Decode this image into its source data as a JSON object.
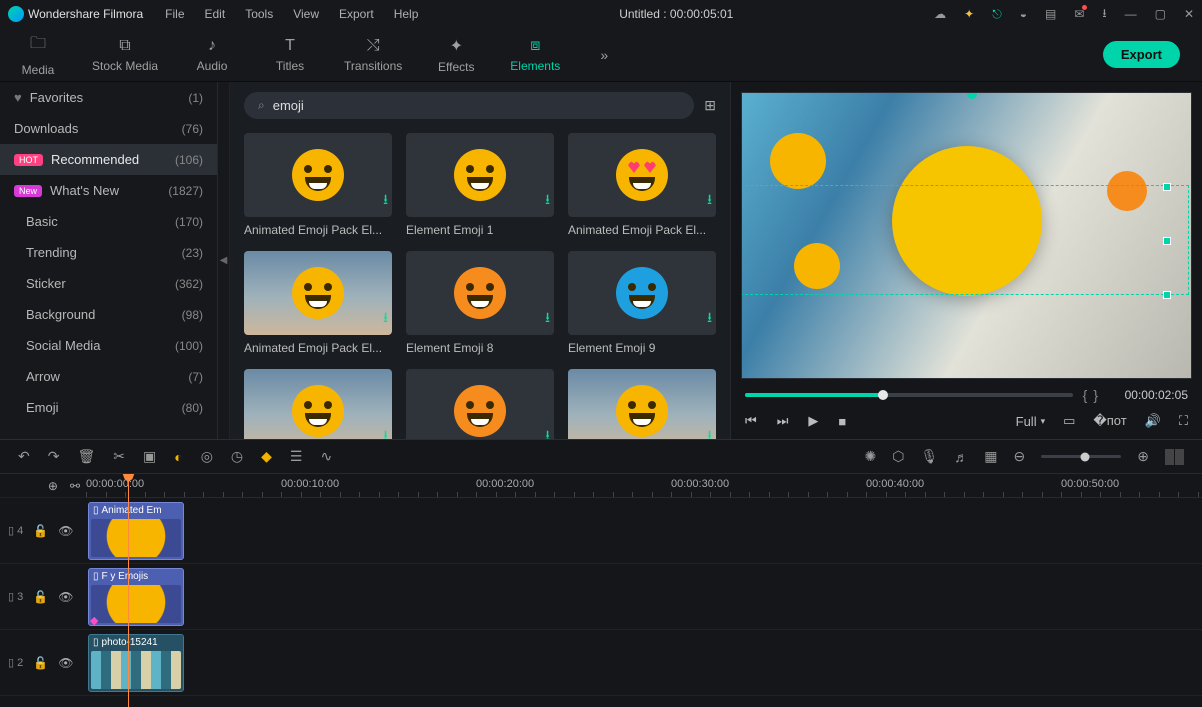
{
  "brand": "Wondershare Filmora",
  "menu": [
    "File",
    "Edit",
    "Tools",
    "View",
    "Export",
    "Help"
  ],
  "title_center": "Untitled : 00:00:05:01",
  "tabs": [
    {
      "label": "Media",
      "icon": "folder"
    },
    {
      "label": "Stock Media",
      "icon": "camera"
    },
    {
      "label": "Audio",
      "icon": "music"
    },
    {
      "label": "Titles",
      "icon": "text"
    },
    {
      "label": "Transitions",
      "icon": "swap"
    },
    {
      "label": "Effects",
      "icon": "sparkle"
    },
    {
      "label": "Elements",
      "icon": "elements",
      "active": true
    }
  ],
  "export_label": "Export",
  "sidebar": {
    "items": [
      {
        "label": "Favorites",
        "count": "(1)",
        "icon": "heart"
      },
      {
        "label": "Downloads",
        "count": "(76)"
      },
      {
        "label": "Recommended",
        "count": "(106)",
        "badge": "HOT",
        "active": true
      },
      {
        "label": "What's New",
        "count": "(1827)",
        "badge": "New"
      },
      {
        "label": "Basic",
        "count": "(170)"
      },
      {
        "label": "Trending",
        "count": "(23)"
      },
      {
        "label": "Sticker",
        "count": "(362)"
      },
      {
        "label": "Background",
        "count": "(98)"
      },
      {
        "label": "Social Media",
        "count": "(100)"
      },
      {
        "label": "Arrow",
        "count": "(7)"
      },
      {
        "label": "Emoji",
        "count": "(80)"
      }
    ]
  },
  "search_value": "emoji",
  "cards": [
    {
      "label": "Animated Emoji Pack El...",
      "variant": "sweat"
    },
    {
      "label": "Element Emoji 1",
      "variant": "smile"
    },
    {
      "label": "Animated Emoji Pack El...",
      "variant": "hearts"
    },
    {
      "label": "Animated Emoji Pack El...",
      "variant": "scene"
    },
    {
      "label": "Element Emoji 8",
      "variant": "orange"
    },
    {
      "label": "Element Emoji 9",
      "variant": "smallblue"
    },
    {
      "label": "",
      "variant": "scene"
    },
    {
      "label": "",
      "variant": "orange"
    },
    {
      "label": "",
      "variant": "scene"
    }
  ],
  "preview": {
    "quality": "Full",
    "time": "00:00:02:05"
  },
  "timeline": {
    "ruler": [
      "00:00:00:00",
      "00:00:10:00",
      "00:00:20:00",
      "00:00:30:00",
      "00:00:40:00",
      "00:00:50:00"
    ],
    "tracks": [
      {
        "name": "4",
        "clip": "Animated Em",
        "thumb": "kiss"
      },
      {
        "name": "3",
        "clip": "F    y Emojis",
        "thumb": "kiss"
      },
      {
        "name": "2",
        "clip": "photo-15241",
        "thumb": "photo"
      }
    ]
  }
}
